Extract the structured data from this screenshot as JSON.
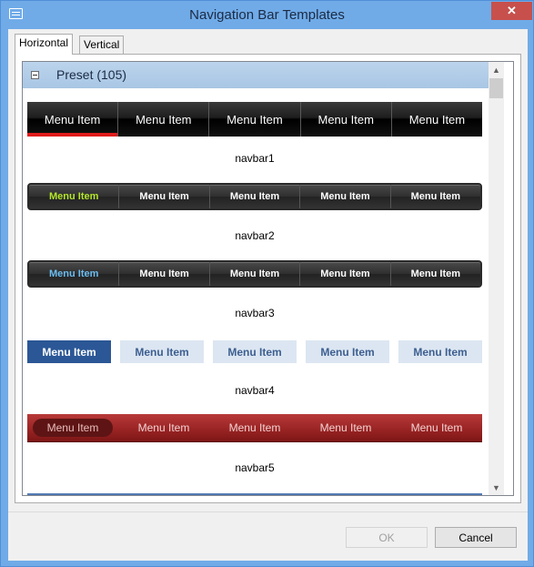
{
  "window": {
    "title": "Navigation Bar Templates",
    "close_glyph": "✕",
    "icon": "window-app-icon"
  },
  "tabs": [
    {
      "label": "Horizontal",
      "active": true
    },
    {
      "label": "Vertical",
      "active": false
    }
  ],
  "group": {
    "title": "Preset (105)",
    "collapse_glyph": "−"
  },
  "navbars": [
    {
      "name": "navbar1",
      "items": [
        "Menu Item",
        "Menu Item",
        "Menu Item",
        "Menu Item",
        "Menu Item"
      ],
      "active_index": 0,
      "accent": "#e01b1b"
    },
    {
      "name": "navbar2",
      "items": [
        "Menu Item",
        "Menu Item",
        "Menu Item",
        "Menu Item",
        "Menu Item"
      ],
      "active_index": 0,
      "accent": "#b5e72a"
    },
    {
      "name": "navbar3",
      "items": [
        "Menu Item",
        "Menu Item",
        "Menu Item",
        "Menu Item",
        "Menu Item"
      ],
      "active_index": 0,
      "accent": "#6cbcf0"
    },
    {
      "name": "navbar4",
      "items": [
        "Menu Item",
        "Menu Item",
        "Menu Item",
        "Menu Item",
        "Menu Item"
      ],
      "active_index": 0,
      "accent": "#2b5796"
    },
    {
      "name": "navbar5",
      "items": [
        "Menu Item",
        "Menu Item",
        "Menu Item",
        "Menu Item",
        "Menu Item"
      ],
      "active_index": 0,
      "accent": "#9a2424"
    }
  ],
  "scrollbar": {
    "up_glyph": "▲",
    "down_glyph": "▼"
  },
  "buttons": {
    "ok": "OK",
    "cancel": "Cancel"
  }
}
